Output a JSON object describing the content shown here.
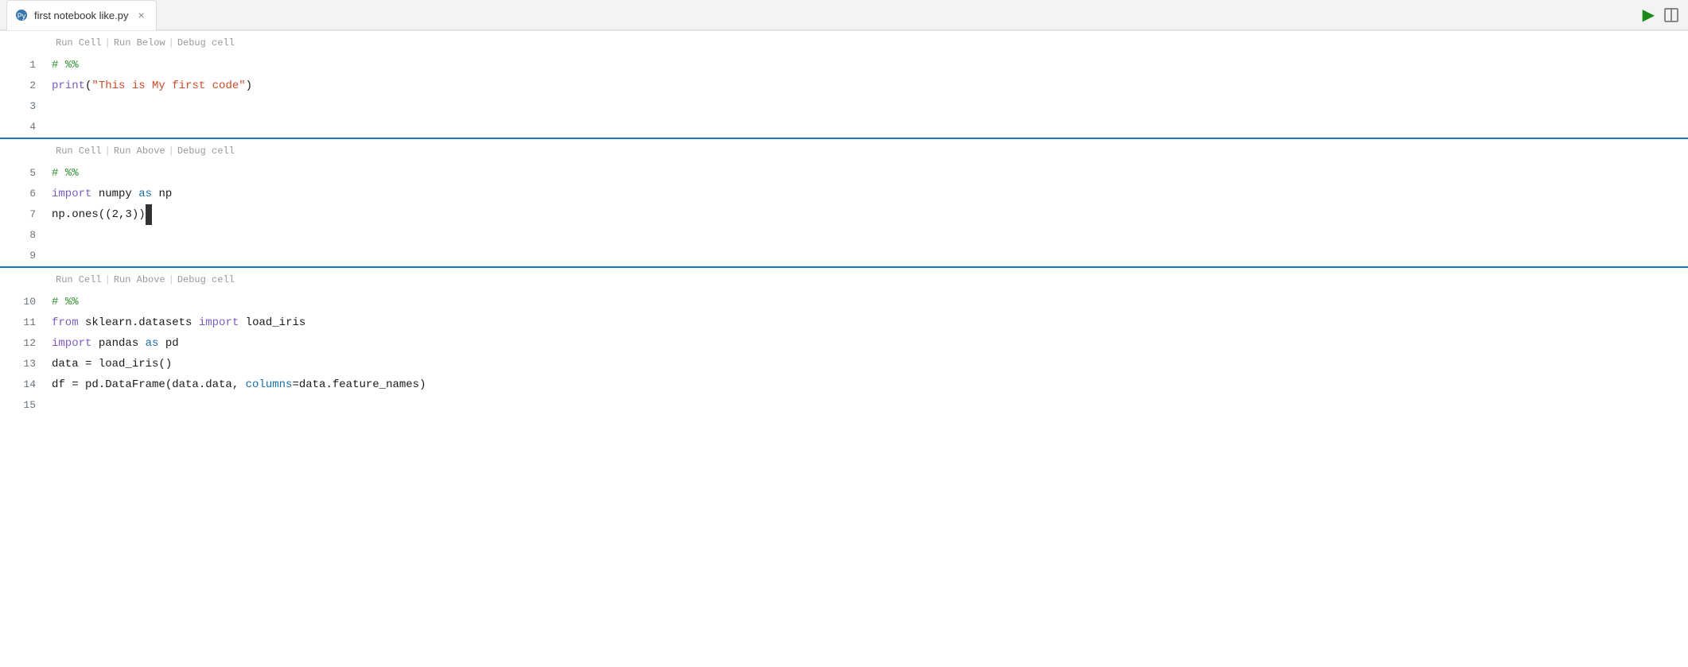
{
  "tab": {
    "icon": "🐍",
    "title": "first notebook like.py",
    "close_label": "×"
  },
  "toolbar": {
    "run_label": "▶",
    "split_label": "⬜"
  },
  "cell1": {
    "actions": {
      "run": "Run Cell",
      "sep1": "|",
      "below": "Run Below",
      "sep2": "|",
      "debug": "Debug cell"
    },
    "lines": [
      {
        "num": "1",
        "tokens": [
          {
            "text": "# %%",
            "class": "kw-comment"
          }
        ]
      },
      {
        "num": "2",
        "tokens": [
          {
            "text": "print",
            "class": "kw-import"
          },
          {
            "text": "(",
            "class": "kw-normal"
          },
          {
            "text": "\"This is My first code\"",
            "class": "kw-string"
          },
          {
            "text": ")",
            "class": "kw-normal"
          }
        ]
      },
      {
        "num": "3",
        "tokens": []
      },
      {
        "num": "4",
        "tokens": []
      }
    ]
  },
  "cell2": {
    "actions": {
      "run": "Run Cell",
      "sep1": "|",
      "above": "Run Above",
      "sep2": "|",
      "debug": "Debug cell"
    },
    "lines": [
      {
        "num": "5",
        "tokens": [
          {
            "text": "# %%",
            "class": "kw-comment"
          }
        ]
      },
      {
        "num": "6",
        "tokens": [
          {
            "text": "import",
            "class": "kw-import"
          },
          {
            "text": " numpy ",
            "class": "kw-normal"
          },
          {
            "text": "as",
            "class": "kw-as"
          },
          {
            "text": " np",
            "class": "kw-normal"
          }
        ]
      },
      {
        "num": "7",
        "tokens": [
          {
            "text": "np.ones((2,3))",
            "class": "kw-normal",
            "cursor_after": true
          }
        ]
      },
      {
        "num": "8",
        "tokens": []
      },
      {
        "num": "9",
        "tokens": []
      }
    ]
  },
  "cell3": {
    "actions": {
      "run": "Run Cell",
      "sep1": "|",
      "above": "Run Above",
      "sep2": "|",
      "debug": "Debug cell"
    },
    "lines": [
      {
        "num": "10",
        "tokens": [
          {
            "text": "# %%",
            "class": "kw-comment"
          }
        ]
      },
      {
        "num": "11",
        "tokens": [
          {
            "text": "from",
            "class": "kw-import"
          },
          {
            "text": " sklearn.datasets ",
            "class": "kw-normal"
          },
          {
            "text": "import",
            "class": "kw-import"
          },
          {
            "text": " load_iris",
            "class": "kw-normal"
          }
        ]
      },
      {
        "num": "12",
        "tokens": [
          {
            "text": "import",
            "class": "kw-import"
          },
          {
            "text": " pandas ",
            "class": "kw-normal"
          },
          {
            "text": "as",
            "class": "kw-as"
          },
          {
            "text": " pd",
            "class": "kw-normal"
          }
        ]
      },
      {
        "num": "13",
        "tokens": [
          {
            "text": "data = load_iris()",
            "class": "kw-normal"
          }
        ]
      },
      {
        "num": "14",
        "tokens": [
          {
            "text": "df = pd.DataFrame(data.data, ",
            "class": "kw-normal"
          },
          {
            "text": "columns",
            "class": "kw-columns"
          },
          {
            "text": "=data.feature_names)",
            "class": "kw-normal"
          }
        ]
      },
      {
        "num": "15",
        "tokens": []
      }
    ]
  }
}
